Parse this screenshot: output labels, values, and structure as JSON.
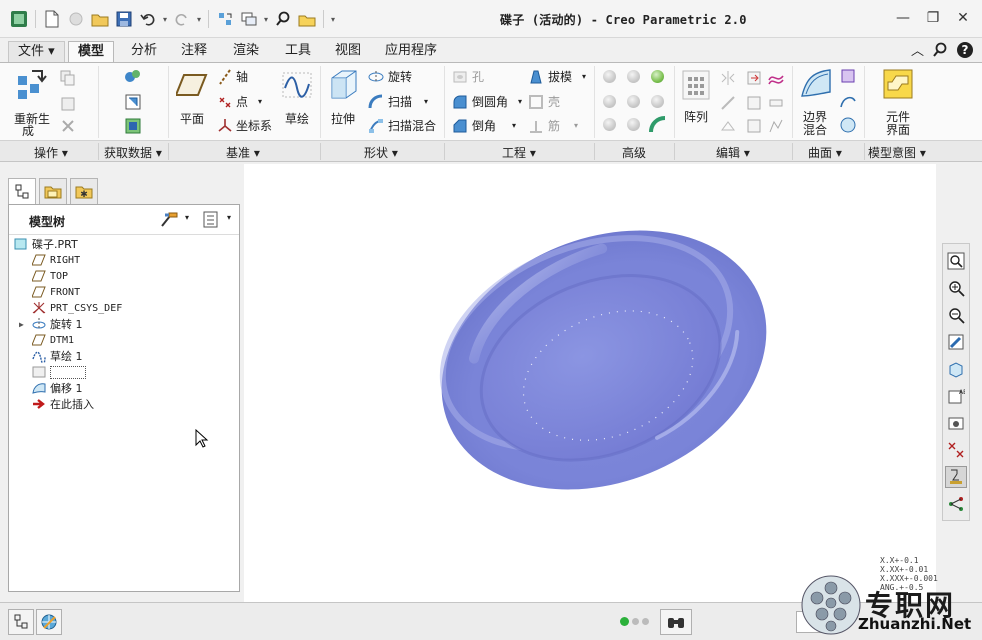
{
  "window": {
    "title": "碟子 (活动的) - Creo Parametric 2.0"
  },
  "tabs": [
    {
      "label": "文件 ▾"
    },
    {
      "label": "模型"
    },
    {
      "label": "分析"
    },
    {
      "label": "注释"
    },
    {
      "label": "渲染"
    },
    {
      "label": "工具"
    },
    {
      "label": "视图"
    },
    {
      "label": "应用程序"
    }
  ],
  "ribbon": {
    "operations": {
      "regenerate": "重新生",
      "regenerate2": "成"
    },
    "datum": {
      "plane": "平面",
      "axis": "轴",
      "point": "点",
      "csys": "坐标系",
      "sketch": "草绘"
    },
    "shapes": {
      "extrude": "拉伸",
      "revolve": "旋转",
      "sweep": "扫描",
      "swept_blend": "扫描混合"
    },
    "engineering": {
      "hole": "孔",
      "round": "倒圆角",
      "chamfer": "倒角",
      "draft": "拔模",
      "shell": "壳",
      "rib": "筋"
    },
    "editing": {
      "pattern": "阵列"
    },
    "surfaces": {
      "boundary_blend": "边界",
      "boundary_blend2": "混合"
    },
    "model_intent": {
      "component": "元件",
      "component2": "界面"
    }
  },
  "groups": [
    {
      "label": "操作 ▾"
    },
    {
      "label": "获取数据 ▾"
    },
    {
      "label": "基准 ▾"
    },
    {
      "label": "形状 ▾"
    },
    {
      "label": "工程 ▾"
    },
    {
      "label": "高级"
    },
    {
      "label": "编辑 ▾"
    },
    {
      "label": "曲面 ▾"
    },
    {
      "label": "模型意图 ▾"
    }
  ],
  "model_tree": {
    "title": "模型树",
    "items": [
      {
        "label": "碟子.PRT",
        "icon": "part-icon"
      },
      {
        "label": "RIGHT",
        "icon": "datum-plane-icon"
      },
      {
        "label": "TOP",
        "icon": "datum-plane-icon"
      },
      {
        "label": "FRONT",
        "icon": "datum-plane-icon"
      },
      {
        "label": "PRT_CSYS_DEF",
        "icon": "csys-icon"
      },
      {
        "label": "旋转 1",
        "icon": "revolve-icon"
      },
      {
        "label": "DTM1",
        "icon": "datum-plane-icon"
      },
      {
        "label": "草绘 1",
        "icon": "sketch-icon"
      },
      {
        "label": "",
        "icon": "feature-icon"
      },
      {
        "label": "偏移 1",
        "icon": "offset-icon"
      },
      {
        "label": "在此插入",
        "icon": "insert-here-icon"
      }
    ]
  },
  "tolerance": [
    "X.X+-0.1",
    "X.XX+-0.01",
    "X.XXX+-0.001",
    "ANG.+-0.5"
  ],
  "watermark": {
    "cn": "专职网",
    "url": "Zhuanzhi.Net"
  },
  "colors": {
    "part": "#7a84d8",
    "accent": "#3a6fb5"
  }
}
